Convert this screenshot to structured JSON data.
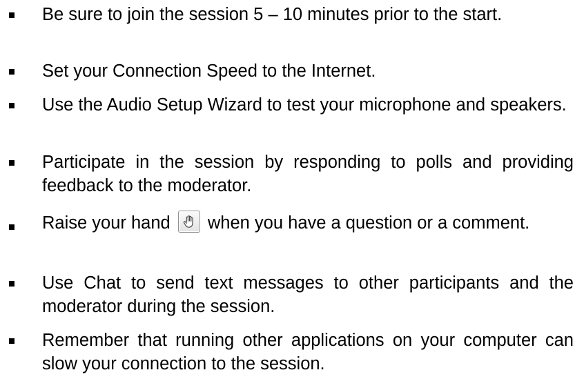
{
  "items": [
    {
      "text": "Be sure to join the session 5 – 10 minutes prior to the start."
    },
    {
      "text": "Set your Connection Speed to the Internet."
    },
    {
      "text": "Use the Audio Setup Wizard to test your microphone and speakers."
    },
    {
      "text": "Participate in the session by responding to polls and providing feedback to the moderator."
    },
    {
      "text_before": "Raise your hand",
      "icon": "raise-hand-icon",
      "text_after": "when you have a question or a comment."
    },
    {
      "text": "Use Chat to send text messages to other participants and the moderator during the session."
    },
    {
      "text": "Remember that running other applications on your computer can slow your connection to the session."
    }
  ]
}
